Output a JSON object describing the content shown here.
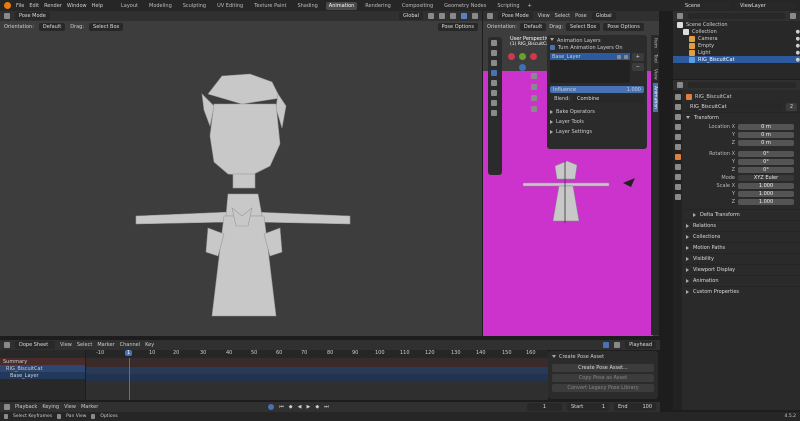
{
  "menu": {
    "items": [
      "File",
      "Edit",
      "Render",
      "Window",
      "Help"
    ],
    "workspaces": [
      "Layout",
      "Modeling",
      "Sculpting",
      "UV Editing",
      "Texture Paint",
      "Shading",
      "Animation",
      "Rendering",
      "Compositing",
      "Geometry Nodes",
      "Scripting"
    ],
    "active_workspace": "Animation",
    "scene": "Scene",
    "view_layer": "ViewLayer"
  },
  "vp_left": {
    "mode": "Pose Mode",
    "orientation_label": "Orientation:",
    "orientation": "Default",
    "drag_label": "Drag:",
    "drag": "Select Box",
    "transform": "Global",
    "pose_options": "Pose Options"
  },
  "vp_right": {
    "mode": "Pose Mode",
    "menus": [
      "View",
      "Select",
      "Pose"
    ],
    "transform": "Global",
    "orientation_label": "Orientation:",
    "orientation": "Default",
    "drag_label": "Drag:",
    "drag": "Select Box",
    "pose_options": "Pose Options",
    "view_name": "User Perspective",
    "view_sub": "(1) RIG_BiscuitCat",
    "layers_panel": {
      "title": "Animation Layers",
      "turn_on": "Turn Animation Layers On",
      "layer": "Base_Layer",
      "influence_label": "Influence",
      "influence": "1.000",
      "blend_label": "Blend:",
      "blend": "Combine",
      "sections": [
        "Bake Operators",
        "Layer Tools",
        "Layer Settings"
      ]
    },
    "side_tabs": [
      "Item",
      "Tool",
      "View",
      "Animation"
    ]
  },
  "outliner": {
    "title": "Scene Collection",
    "items": [
      {
        "name": "Collection",
        "indent": 0
      },
      {
        "name": "Camera",
        "indent": 1
      },
      {
        "name": "Empty",
        "indent": 1
      },
      {
        "name": "Light",
        "indent": 1
      },
      {
        "name": "RIG_BiscuitCat",
        "indent": 1
      }
    ]
  },
  "properties": {
    "object": "RIG_BiscuitCat",
    "name_field": "RIG_BiscuitCat",
    "users": "2",
    "transform": "Transform",
    "location_label": "Location X",
    "rotation_label": "Rotation X",
    "mode_label": "Mode",
    "mode": "XYZ Euler",
    "scale_label": "Scale X",
    "axis_y": "Y",
    "axis_z": "Z",
    "location": [
      "0 m",
      "0 m",
      "0 m"
    ],
    "rotation": [
      "0°",
      "0°",
      "0°"
    ],
    "scale": [
      "1.000",
      "1.000",
      "1.000"
    ],
    "delta": "Delta Transform",
    "sections": [
      "Relations",
      "Collections",
      "Motion Paths",
      "Visibility",
      "Viewport Display",
      "Animation",
      "Custom Properties"
    ]
  },
  "dopesheet": {
    "editor": "Dope Sheet",
    "menus": [
      "View",
      "Select",
      "Marker",
      "Channel",
      "Key"
    ],
    "playhead_label": "Playhead",
    "ticks": [
      "-10",
      "1",
      "10",
      "20",
      "30",
      "40",
      "50",
      "60",
      "70",
      "80",
      "90",
      "100",
      "110",
      "120",
      "130",
      "140",
      "150",
      "160"
    ],
    "current_frame": "1",
    "channels": [
      "Summary",
      "RIG_BiscuitCat",
      "Base_Layer"
    ],
    "pose_panel": {
      "title": "Create Pose Asset",
      "btn1": "Create Pose Asset...",
      "btn2": "Copy Pose as Asset",
      "btn3": "Convert Legacy Pose Library"
    }
  },
  "timeline": {
    "menus": [
      "Playback",
      "Keying",
      "View",
      "Marker"
    ],
    "frame": "1",
    "start_label": "Start",
    "start": "1",
    "end_label": "End",
    "end": "100"
  },
  "status": {
    "left": "Select Keyframes",
    "middle": "Pan View",
    "right": "Options",
    "version": "4.5.2"
  },
  "colors": {
    "accent": "#4772b3",
    "magenta": "#cc33cc",
    "highlight": "#2d5a9c"
  }
}
